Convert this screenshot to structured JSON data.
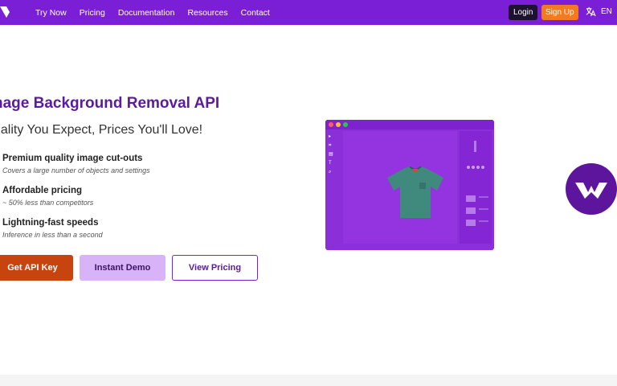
{
  "nav": {
    "links": [
      "Try Now",
      "Pricing",
      "Documentation",
      "Resources",
      "Contact"
    ],
    "login_label": "Login",
    "signup_label": "Sign Up",
    "language": "EN"
  },
  "hero": {
    "title": "nage Background Removal API",
    "subtitle": "uality You Expect, Prices You'll Love!",
    "features": [
      {
        "title": "Premium quality image cut-outs",
        "desc": "Covers a large number of objects and settings"
      },
      {
        "title": "Affordable pricing",
        "desc": "~ 50% less than competitors"
      },
      {
        "title": "Lightning-fast speeds",
        "desc": "Inference in less than a second"
      }
    ],
    "cta": {
      "api_key": "Get API Key",
      "demo": "Instant Demo",
      "pricing": "View Pricing"
    }
  },
  "colors": {
    "nav_bg": "#7a1fd6",
    "accent_orange": "#f27b22",
    "cta_red": "#c8440f",
    "demo_bg": "#d9b3f7",
    "title_purple": "#5b1b9c"
  },
  "icons": {
    "logo": "brand-logo-icon",
    "language": "translate-icon",
    "badge": "brand-w-icon"
  }
}
